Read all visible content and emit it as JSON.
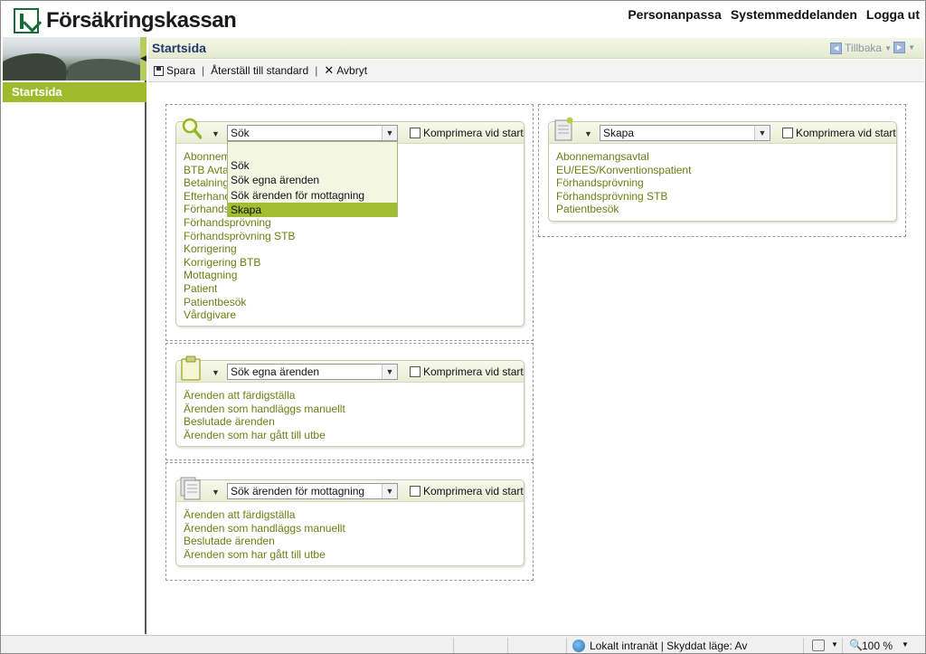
{
  "header": {
    "brand": "Försäkringskassan",
    "links": [
      "Personanpassa",
      "Systemmeddelanden",
      "Logga ut"
    ]
  },
  "sidebar": {
    "items": [
      {
        "label": "Startsida"
      }
    ]
  },
  "titlebar": {
    "title": "Startsida",
    "back_label": "Tillbaka"
  },
  "toolbar": {
    "save": "Spara",
    "reset": "Återställ till standard",
    "cancel": "Avbryt"
  },
  "widgets": {
    "sok": {
      "selected": "Sök",
      "compress_label": "Komprimera vid start",
      "links": [
        "Abonnem",
        "BTB Avta",
        "Betalning",
        "Efterhand",
        "Förhands",
        "Förhandsprövning",
        "Förhandsprövning STB",
        "Korrigering",
        "Korrigering BTB",
        "Mottagning",
        "Patient",
        "Patientbesök",
        "Vårdgivare"
      ],
      "dropdown_options": [
        "Sök",
        "Sök egna ärenden",
        "Sök ärenden för mottagning",
        "Skapa"
      ],
      "dropdown_active": "Skapa"
    },
    "egna": {
      "selected": "Sök egna ärenden",
      "compress_label": "Komprimera vid start",
      "links": [
        "Ärenden att färdigställa",
        "Ärenden som handläggs manuellt",
        "Beslutade ärenden",
        "Ärenden som har gått till utbe"
      ]
    },
    "mottagning": {
      "selected": "Sök ärenden för mottagning",
      "compress_label": "Komprimera vid start",
      "links": [
        "Ärenden att färdigställa",
        "Ärenden som handläggs manuellt",
        "Beslutade ärenden",
        "Ärenden som har gått till utbe"
      ]
    },
    "skapa": {
      "selected": "Skapa",
      "compress_label": "Komprimera vid start",
      "links": [
        "Abonnemangsavtal",
        "EU/EES/Konventionspatient",
        "Förhandsprövning",
        "Förhandsprövning STB",
        "Patientbesök"
      ]
    }
  },
  "statusbar": {
    "zone": "Lokalt intranät | Skyddat läge: Av",
    "zoom": "100 %"
  },
  "colors": {
    "accent": "#9fbb2c",
    "link": "#6b7f14",
    "title": "#23376a"
  },
  "icons": [
    "search-icon",
    "clipboard-icon",
    "documents-icon",
    "new-document-icon",
    "save-icon",
    "close-icon",
    "globe-icon"
  ]
}
